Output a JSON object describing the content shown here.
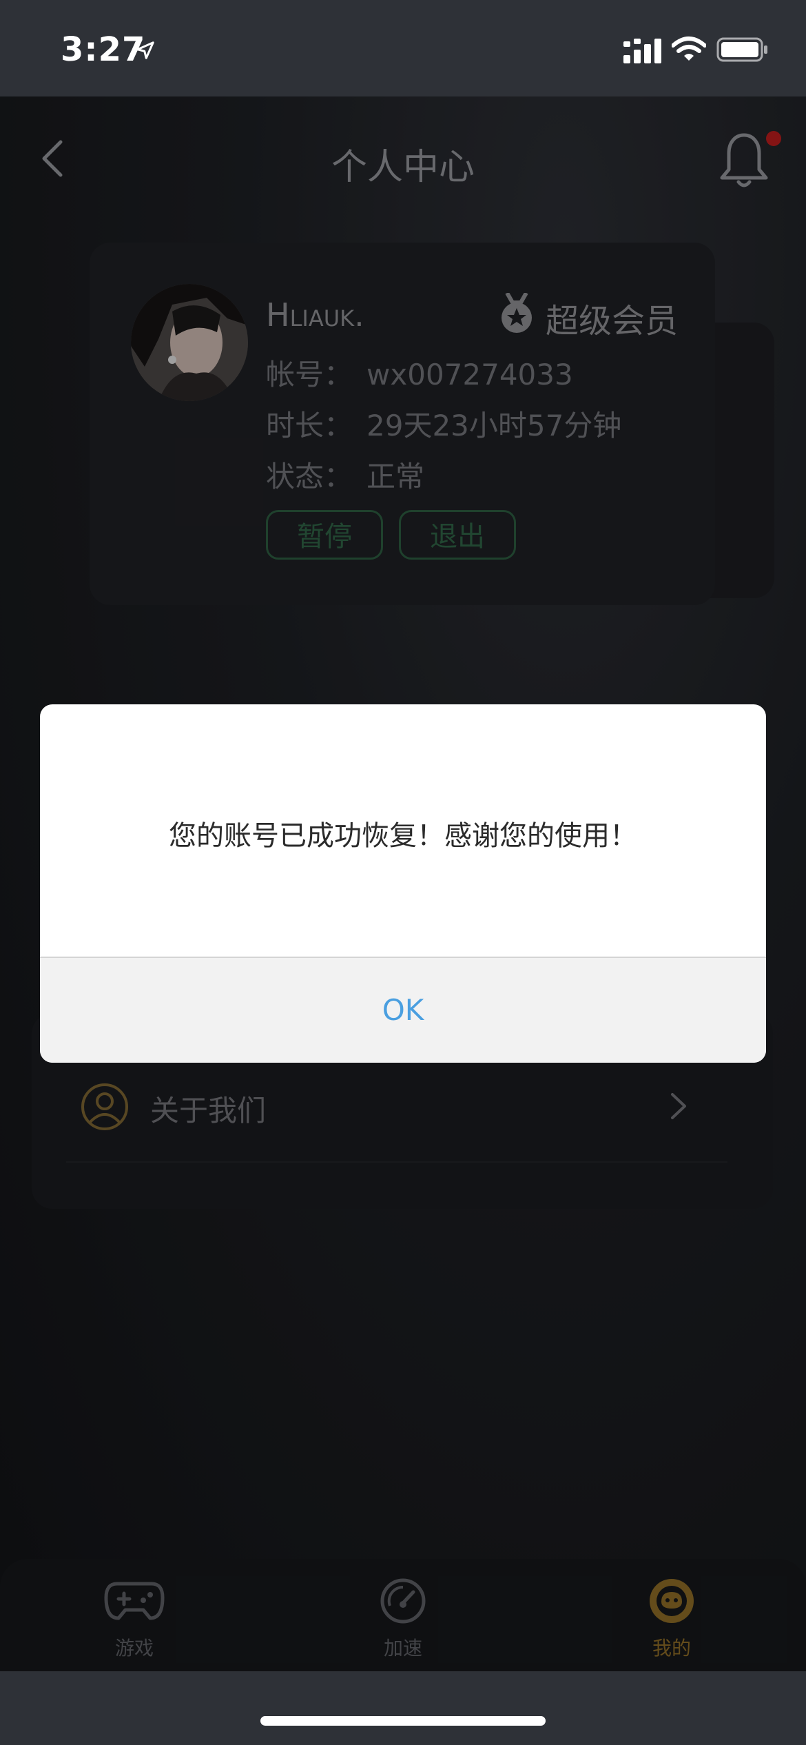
{
  "status_bar": {
    "time": "3:27"
  },
  "header": {
    "title": "个人中心"
  },
  "profile": {
    "username": "Hliauk.",
    "vip_label": "超级会员",
    "account_label": "帐号：",
    "account_value": "wx007274033",
    "duration_label": "时长：",
    "duration_value": "29天23小时57分钟",
    "status_label": "状态：",
    "status_value": "正常",
    "pause_label": "暂停",
    "logout_label": "退出"
  },
  "menu": {
    "about_label": "关于我们"
  },
  "dialog": {
    "message": "您的账号已成功恢复！感谢您的使用！",
    "ok_label": "OK"
  },
  "tabs": [
    {
      "label": "游戏",
      "icon": "gamepad-icon",
      "active": false
    },
    {
      "label": "加速",
      "icon": "speedometer-icon",
      "active": false
    },
    {
      "label": "我的",
      "icon": "profile-face-icon",
      "active": true
    }
  ],
  "colors": {
    "accent_green": "#2f6244",
    "accent_gold": "#8b6a26",
    "dialog_ok": "#4a9fe0",
    "notification_dot": "#b71c1c"
  }
}
